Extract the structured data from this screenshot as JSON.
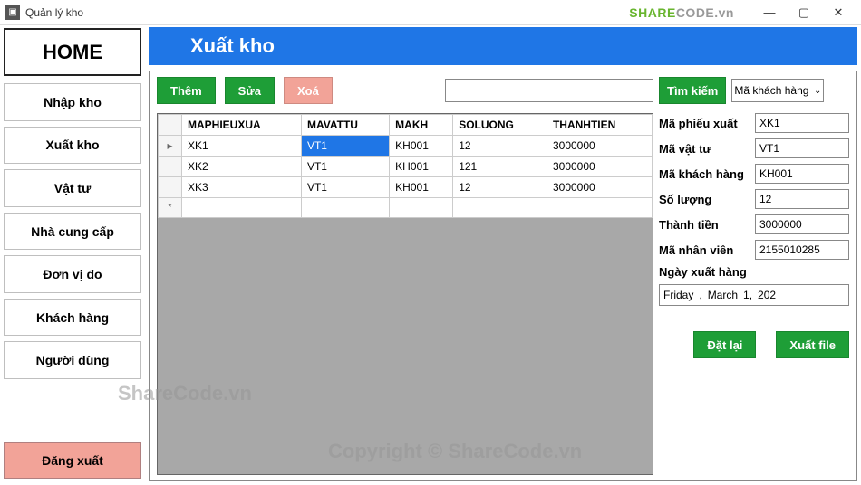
{
  "window": {
    "title": "Quản lý kho"
  },
  "watermarks": {
    "logo_prefix": "SHARE",
    "logo_suffix": "CODE.vn",
    "text1": "ShareCode.vn",
    "text2": "Copyright © ShareCode.vn"
  },
  "sidebar": {
    "home": "HOME",
    "items": [
      "Nhập kho",
      "Xuất kho",
      "Vật tư",
      "Nhà cung cấp",
      "Đơn vị đo",
      "Khách hàng",
      "Người dùng"
    ],
    "logout": "Đăng xuất"
  },
  "header": {
    "title": "Xuất kho"
  },
  "toolbar": {
    "add": "Thêm",
    "edit": "Sửa",
    "delete": "Xoá",
    "search_value": "",
    "search_btn": "Tìm kiếm",
    "filter_selected": "Mã khách hàng"
  },
  "grid": {
    "columns": [
      "MAPHIEUXUA",
      "MAVATTU",
      "MAKH",
      "SOLUONG",
      "THANHTIEN"
    ],
    "rows": [
      {
        "maphieuxua": "XK1",
        "mavattu": "VT1",
        "makh": "KH001",
        "soluong": "12",
        "thanhtien": "3000000",
        "selected": true,
        "marker": "▸"
      },
      {
        "maphieuxua": "XK2",
        "mavattu": "VT1",
        "makh": "KH001",
        "soluong": "121",
        "thanhtien": "3000000"
      },
      {
        "maphieuxua": "XK3",
        "mavattu": "VT1",
        "makh": "KH001",
        "soluong": "12",
        "thanhtien": "3000000"
      }
    ],
    "new_marker": "*"
  },
  "form": {
    "maphieuxuat_label": "Mã phiếu xuất",
    "maphieuxuat": "XK1",
    "mavattu_label": "Mã vật tư",
    "mavattu": "VT1",
    "makh_label": "Mã khách hàng",
    "makh": "KH001",
    "soluong_label": "Số lượng",
    "soluong": "12",
    "thanhtien_label": "Thành tiền",
    "thanhtien": "3000000",
    "manv_label": "Mã nhân viên",
    "manv": "2155010285",
    "date_label": "Ngày xuất hàng",
    "date_weekday": "Friday",
    "date_sep": ",",
    "date_month": "March",
    "date_day": "1,",
    "date_year": "202"
  },
  "actions": {
    "reset": "Đặt lại",
    "export": "Xuất file"
  }
}
